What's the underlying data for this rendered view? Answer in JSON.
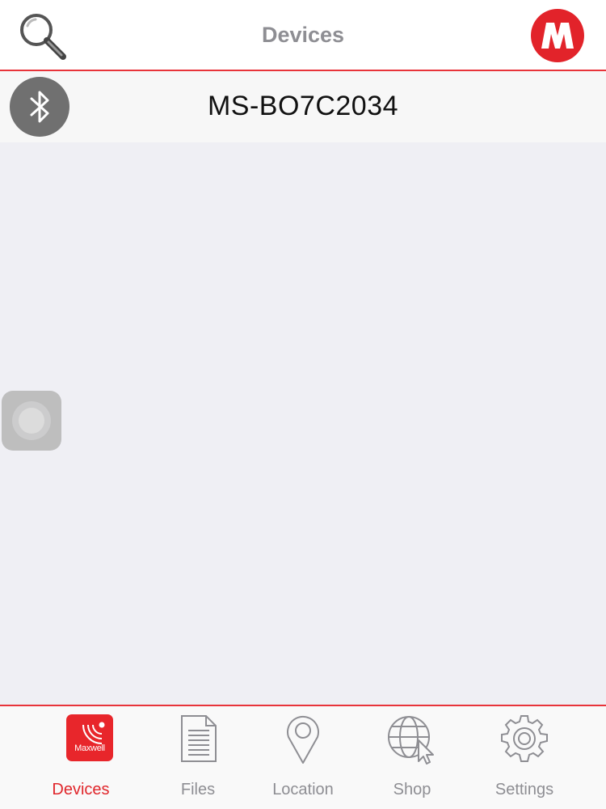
{
  "header": {
    "title": "Devices",
    "search_icon": "search-icon",
    "logo_icon": "maxwell-logo-icon",
    "accent_color": "#e8343a"
  },
  "device_list": {
    "items": [
      {
        "name": "MS-BO7C2034",
        "icon": "bluetooth-icon"
      }
    ]
  },
  "overlay": {
    "assistive_touch_icon": "assistive-touch-icon"
  },
  "tab_bar": {
    "active_color": "#e0262b",
    "inactive_color": "#8e8e93",
    "tabs": [
      {
        "label": "Devices",
        "icon": "maxwell-app-icon",
        "active": true,
        "badge_text": "Maxwell"
      },
      {
        "label": "Files",
        "icon": "document-icon",
        "active": false
      },
      {
        "label": "Location",
        "icon": "location-pin-icon",
        "active": false
      },
      {
        "label": "Shop",
        "icon": "globe-cursor-icon",
        "active": false
      },
      {
        "label": "Settings",
        "icon": "gear-icon",
        "active": false
      }
    ]
  }
}
